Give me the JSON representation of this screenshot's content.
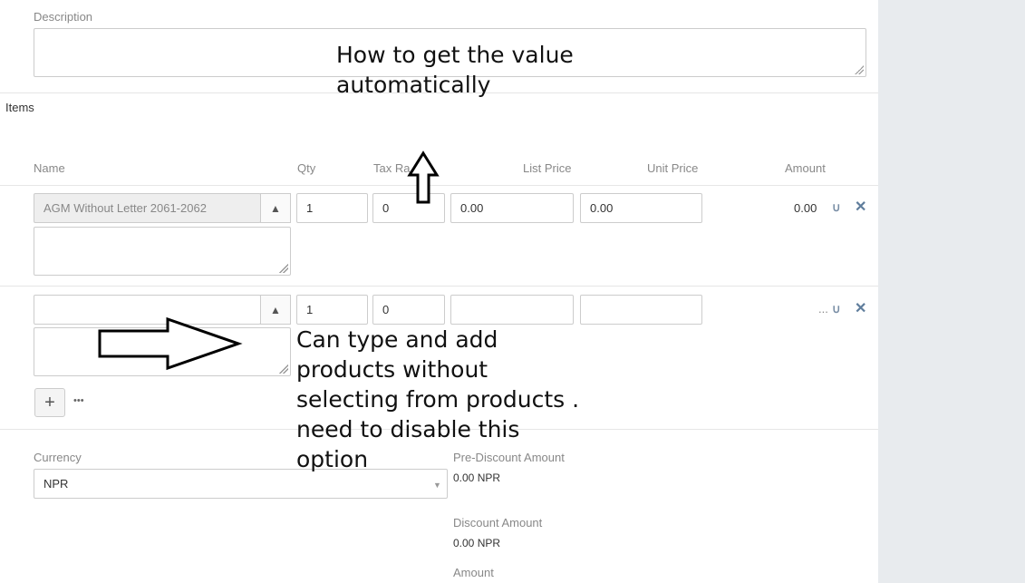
{
  "form": {
    "description_label": "Description",
    "items_label": "Items",
    "columns": {
      "name": "Name",
      "qty": "Qty",
      "tax_rate": "Tax Ra",
      "list_price": "List Price",
      "unit_price": "Unit Price",
      "amount": "Amount"
    },
    "rows": [
      {
        "name": "AGM Without Letter 2061-2062",
        "qty": "1",
        "tax": "0",
        "list_price": "0.00",
        "unit_price": "0.00",
        "amount": "0.00"
      },
      {
        "name": "",
        "qty": "1",
        "tax": "0",
        "list_price": "",
        "unit_price": "",
        "amount": "..."
      }
    ],
    "add_button": "+",
    "more_button": "•••",
    "currency_label": "Currency",
    "currency_value": "NPR",
    "pre_discount_label": "Pre-Discount Amount",
    "pre_discount_value": "0.00 NPR",
    "discount_label": "Discount Amount",
    "discount_value": "0.00 NPR",
    "amount_label": "Amount"
  },
  "icons": {
    "row_magnet": "magnet-icon",
    "row_remove": "close-icon",
    "select_caret": "chevron-up-icon"
  },
  "annotations": {
    "top": "How to get the value\nautomatically",
    "middle": "Can type and add\nproducts without\nselecting from products .\nneed to disable this\noption"
  }
}
